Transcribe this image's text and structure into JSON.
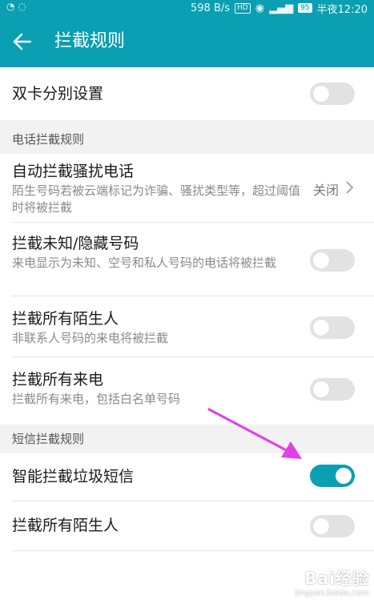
{
  "status_bar": {
    "network_speed": "598 B/s",
    "hd_badge": "HD",
    "battery": "95",
    "time": "半夜12:20"
  },
  "app_bar": {
    "title": "拦截规则"
  },
  "dual_sim": {
    "title": "双卡分别设置",
    "enabled": false
  },
  "call_section": {
    "header": "电话拦截规则",
    "items": [
      {
        "title": "自动拦截骚扰电话",
        "subtitle": "陌生号码若被云端标记为诈骗、骚扰类型等，超过阈值时将被拦截",
        "value": "关闭"
      },
      {
        "title": "拦截未知/隐藏号码",
        "subtitle": "来电显示为未知、空号和私人号码的电话将被拦截",
        "enabled": false
      },
      {
        "title": "拦截所有陌生人",
        "subtitle": "非联系人号码的来电将被拦截",
        "enabled": false
      },
      {
        "title": "拦截所有来电",
        "subtitle": "拦截所有来电，包括白名单号码",
        "enabled": false
      }
    ]
  },
  "sms_section": {
    "header": "短信拦截规则",
    "items": [
      {
        "title": "智能拦截垃圾短信",
        "enabled": true
      },
      {
        "title": "拦截所有陌生人",
        "enabled": false
      }
    ]
  },
  "watermark": {
    "main": "Bai经验",
    "sub": "jingyan.baidu.com"
  },
  "colors": {
    "accent": "#0a9fb2",
    "annotation_arrow": "#e040e8"
  }
}
